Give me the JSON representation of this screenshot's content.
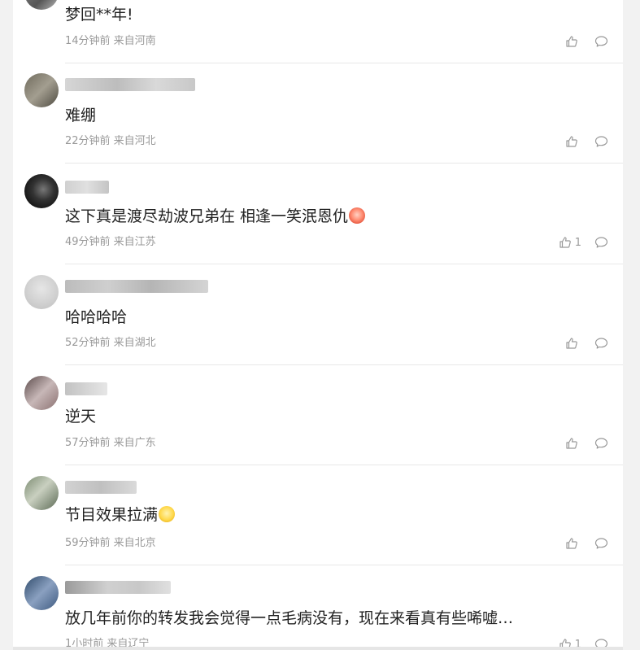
{
  "comments": [
    {
      "text": "梦回**年!",
      "meta": "14分钟前 来自河南",
      "likes": ""
    },
    {
      "text": "难绷",
      "meta": "22分钟前 来自河北",
      "likes": ""
    },
    {
      "text": "这下真是渡尽劫波兄弟在 相逢一笑泯恩仇",
      "meta": "49分钟前 来自江苏",
      "likes": "1"
    },
    {
      "text": "哈哈哈哈",
      "meta": "52分钟前 来自湖北",
      "likes": ""
    },
    {
      "text": "逆天",
      "meta": "57分钟前 来自广东",
      "likes": ""
    },
    {
      "text": "节目效果拉满",
      "meta": "59分钟前 来自北京",
      "likes": ""
    },
    {
      "text": "放几年前你的转发我会觉得一点毛病没有，现在来看真有些唏嘘…",
      "meta": "1小时前 来自辽宁",
      "likes": "1"
    }
  ],
  "icons": {
    "like": "thumbs-up-icon",
    "reply": "comment-bubble-icon"
  },
  "colors": {
    "meta": "#999999",
    "text": "#222222",
    "divider": "#e8e8e8"
  }
}
